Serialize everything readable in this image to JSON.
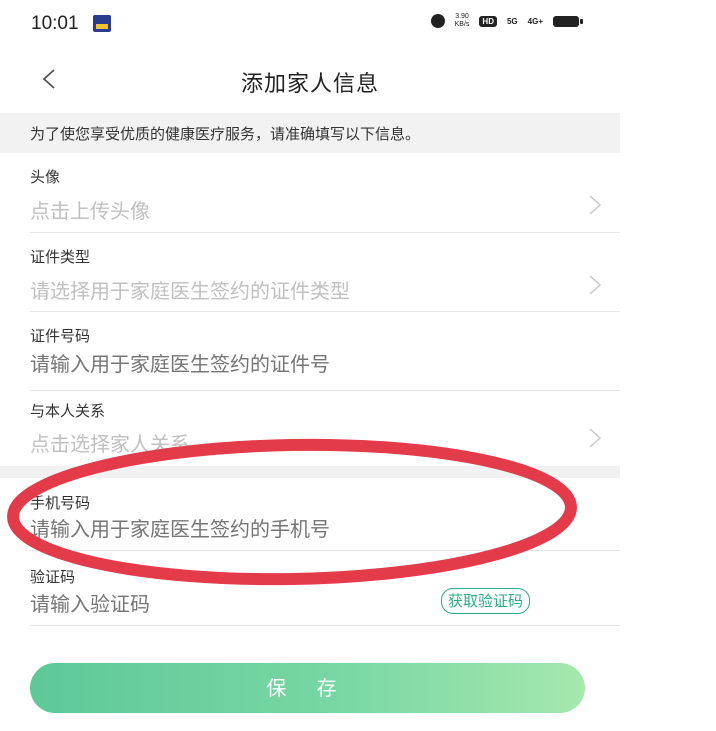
{
  "status_bar": {
    "time": "10:01",
    "speed_value": "3.90",
    "speed_unit": "KB/s",
    "hd_badge": "HD",
    "network_5g": "5G",
    "network_4g": "4G+"
  },
  "header": {
    "title": "添加家人信息"
  },
  "notice": {
    "text": "为了使您享受优质的健康医疗服务，请准确填写以下信息。"
  },
  "form": {
    "avatar": {
      "label": "头像",
      "placeholder": "点击上传头像"
    },
    "id_type": {
      "label": "证件类型",
      "placeholder": "请选择用于家庭医生签约的证件类型"
    },
    "id_number": {
      "label": "证件号码",
      "placeholder": "请输入用于家庭医生签约的证件号"
    },
    "relation": {
      "label": "与本人关系",
      "placeholder": "点击选择家人关系"
    },
    "phone": {
      "label": "手机号码",
      "placeholder": "请输入用于家庭医生签约的手机号"
    },
    "code": {
      "label": "验证码",
      "placeholder": "请输入验证码",
      "button": "获取验证码"
    }
  },
  "save_button": "保 存",
  "colors": {
    "accent_green": "#2daa8a",
    "button_gradient_start": "#5ec898",
    "button_gradient_end": "#a6e8ad",
    "annotation_red": "#e33b4a",
    "placeholder_gray": "#c0c0c0"
  },
  "icons": {
    "back": "back-arrow-icon",
    "chevron": "chevron-right-icon"
  }
}
